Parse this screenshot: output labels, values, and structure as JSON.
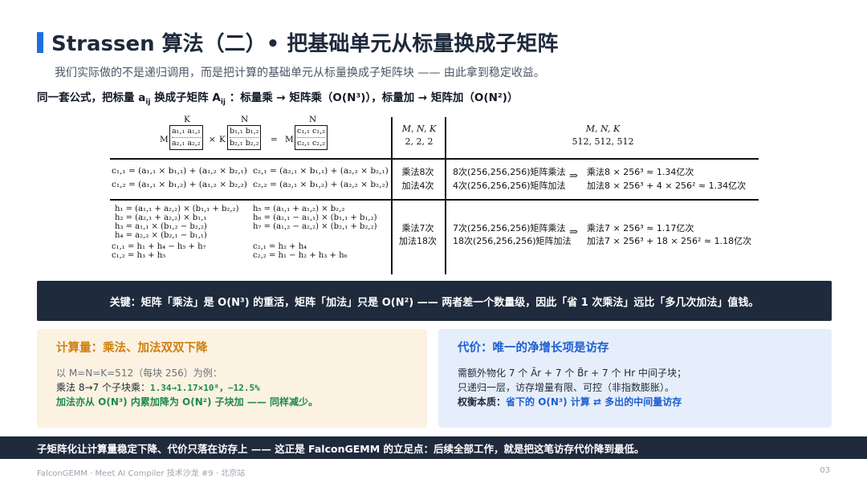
{
  "header": {
    "title": "Strassen 算法（二）• 把基础单元从标量换成子矩阵",
    "subtitle": "我们实际做的不是递归调用，而是把计算的基础单元从标量换成子矩阵块 —— 由此拿到稳定收益。",
    "formula_a": "同一套公式，把标量 a",
    "formula_a_sub": "ij",
    "formula_b": "换成子矩阵 A",
    "formula_b_sub": "ij",
    "formula_c": "：标量乘 → 矩阵乘（O(N³)），标量加 → 矩阵加（O(N²)）"
  },
  "table": {
    "header_left": {
      "k_top": "K",
      "n_top": "N",
      "n_top2": "N",
      "m_left": "M",
      "k_mid": "K",
      "m_left2": "M",
      "times": "×",
      "equals": "=",
      "a11": "a₁,₁",
      "a12": "a₁,₂",
      "a21": "a₂,₁",
      "a22": "a₂,₂",
      "b11": "b₁,₁",
      "b12": "b₁,₂",
      "b21": "b₂,₁",
      "b22": "b₂,₂",
      "c11": "c₁,₁",
      "c12": "c₁,₂",
      "c21": "c₂,₁",
      "c22": "c₂,₂"
    },
    "col2_header": "M, N, K",
    "col2_values": "2, 2, 2",
    "col3_header": "M, N, K",
    "col3_values": "512, 512, 512",
    "row1": {
      "eq1": "c₁,₁ = (a₁,₁ × b₁,₁) + (a₁,₂ × b₂,₁)",
      "eq2": "c₁,₂ = (a₁,₁ × b₁,₂) + (a₁,₂ × b₂,₂)",
      "eq3": "c₂,₁ = (a₂,₁ × b₁,₁) + (a₂,₂ × b₂,₁)",
      "eq4": "c₂,₂ = (a₂,₁ × b₁,₂) + (a₂,₂ × b₂,₂)",
      "mul": "乘法8次",
      "add": "加法4次",
      "big_mul": "8次(256,256,256)矩阵乘法",
      "big_add": "4次(256,256,256)矩阵加法",
      "res_mul": "乘法8 × 256³ ≈ 1.34亿次",
      "res_add": "加法8 × 256³ + 4 × 256² ≈ 1.34亿次"
    },
    "row2": {
      "h1": "h₁ = (a₁,₁ + a₂,₂) × (b₁,₁ + b₂,₂)",
      "h2": "h₂ = (a₂,₁ + a₂,₂) × b₁,₁",
      "h3": "h₃ = a₁,₁ × (b₁,₂ − b₂,₂)",
      "h4": "h₄ = a₂,₂ × (b₂,₁ − b₁,₁)",
      "c11": "c₁,₁ = h₁ + h₄ − h₅ + h₇",
      "c12": "c₁,₂ = h₃ + h₅",
      "h5": "h₅ = (a₁,₁ + a₁,₂) × b₂,₂",
      "h6": "h₆ = (a₂,₁ − a₁,₁) × (b₁,₁ + b₁,₂)",
      "h7": "h₇ = (a₁,₂ − a₂,₂) × (b₂,₁ + b₂,₂)",
      "c21": "c₂,₁ = h₂ + h₄",
      "c22": "c₂,₂ = h₁ − h₂ + h₃ + h₆",
      "mul": "乘法7次",
      "add": "加法18次",
      "big_mul": "7次(256,256,256)矩阵乘法",
      "big_add": "18次(256,256,256)矩阵加法",
      "res_mul": "乘法7 × 256³ ≈ 1.17亿次",
      "res_add": "加法7 × 256³ + 18 × 256² ≈ 1.18亿次"
    },
    "arrow": "⇒"
  },
  "key_banner": "关键：矩阵「乘法」是 O(N³) 的重活，矩阵「加法」只是 O(N²) —— 两者差一个数量级，因此「省 1 次乘法」远比「多几次加法」值钱。",
  "card_left": {
    "title": "计算量：乘法、加法双双下降",
    "line1": "以 M=N=K=512（每块 256）为例：",
    "line2_a": "乘法 8→7 个子块乘：",
    "line2_b": "1.34→1.17×10⁸，−12.5%",
    "line3": "加法亦从 O(N³) 内累加降为 O(N²) 子块加 —— 同样减少。"
  },
  "card_right": {
    "title": "代价：唯一的净增长项是访存",
    "line1": "需额外物化 7 个 Ãr + 7 个 B̃r + 7 个 Hr 中间子块；",
    "line2": "只递归一层，访存增量有限、可控（非指数膨胀）。",
    "line3_a": "权衡本质：",
    "line3_b": "省下的 O(N³) 计算 ⇄ 多出的中间量访存"
  },
  "bottom_bar": "子矩阵化让计算量稳定下降、代价只落在访存上 —— 这正是 FalconGEMM 的立足点：后续全部工作，就是把这笔访存代价降到最低。",
  "footer": {
    "left": "FalconGEMM · Meet AI Compiler 技术沙龙 #9 · 北京站",
    "page": "03"
  },
  "colors": {
    "accent_blue": "#1d6fe0",
    "dark_banner": "#1f2a3c",
    "orange_title": "#cf7f0f",
    "green_text": "#1e8a4a",
    "left_card_bg": "#fbf2e1",
    "right_card_bg": "#e6eefb"
  }
}
